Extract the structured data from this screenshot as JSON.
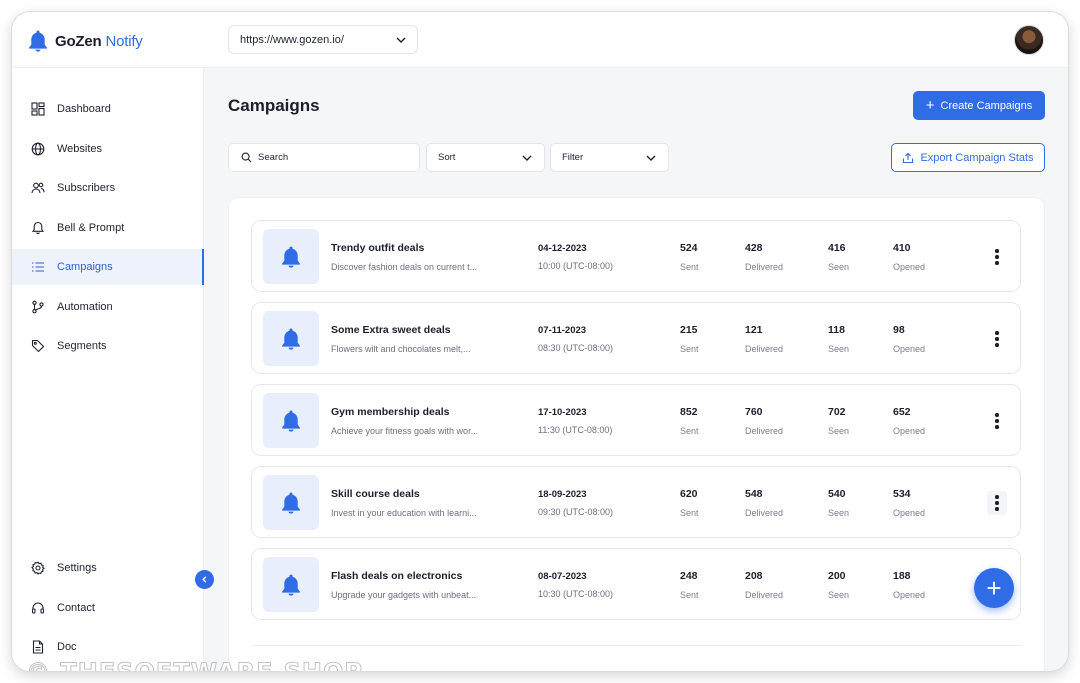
{
  "app": {
    "logo_primary": "GoZen",
    "logo_accent": "Notify",
    "site_url": "https://www.gozen.io/"
  },
  "colors": {
    "accent": "#2f6ce5",
    "active_bg": "#eef2fb",
    "thumb_bg": "#e8eefb"
  },
  "sidebar": {
    "items": [
      {
        "label": "Dashboard",
        "icon": "dashboard-icon"
      },
      {
        "label": "Websites",
        "icon": "globe-icon"
      },
      {
        "label": "Subscribers",
        "icon": "users-icon"
      },
      {
        "label": "Bell & Prompt",
        "icon": "bell-icon"
      },
      {
        "label": "Campaigns",
        "icon": "list-icon",
        "active": true
      },
      {
        "label": "Automation",
        "icon": "branch-icon"
      },
      {
        "label": "Segments",
        "icon": "tag-icon"
      }
    ],
    "bottom_items": [
      {
        "label": "Settings",
        "icon": "gear-icon"
      },
      {
        "label": "Contact",
        "icon": "headset-icon"
      },
      {
        "label": "Doc",
        "icon": "document-icon"
      }
    ]
  },
  "main": {
    "title": "Campaigns",
    "create_label": "Create Campaigns",
    "search_placeholder": "Search",
    "sort_label": "Sort",
    "filter_label": "Filter",
    "export_label": "Export Campaign Stats",
    "stat_labels": {
      "sent": "Sent",
      "delivered": "Delivered",
      "seen": "Seen",
      "opened": "Opened"
    },
    "campaigns": [
      {
        "name": "Trendy outfit deals",
        "desc": "Discover fashion deals on current t...",
        "date": "04-12-2023",
        "time": "10:00 (UTC-08:00)",
        "sent": "524",
        "delivered": "428",
        "seen": "416",
        "opened": "410"
      },
      {
        "name": "Some Extra sweet deals",
        "desc": "Flowers wilt and chocolates melt,...",
        "date": "07-11-2023",
        "time": "08:30 (UTC-08:00)",
        "sent": "215",
        "delivered": "121",
        "seen": "118",
        "opened": "98"
      },
      {
        "name": "Gym membership deals",
        "desc": "Achieve your fitness goals with wor...",
        "date": "17-10-2023",
        "time": "11:30 (UTC-08:00)",
        "sent": "852",
        "delivered": "760",
        "seen": "702",
        "opened": "652"
      },
      {
        "name": "Skill course deals",
        "desc": "Invest in your education with learni...",
        "date": "18-09-2023",
        "time": "09:30 (UTC-08:00)",
        "sent": "620",
        "delivered": "548",
        "seen": "540",
        "opened": "534"
      },
      {
        "name": "Flash deals on electronics",
        "desc": "Upgrade your gadgets with unbeat...",
        "date": "08-07-2023",
        "time": "10:30 (UTC-08:00)",
        "sent": "248",
        "delivered": "208",
        "seen": "200",
        "opened": "188"
      }
    ]
  },
  "watermark": "© THESOFTWARE.SHOP"
}
